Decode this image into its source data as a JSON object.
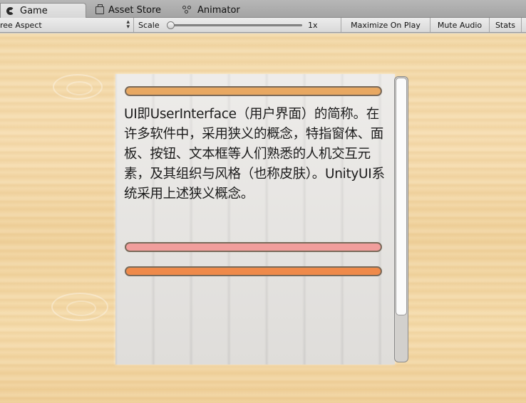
{
  "tabs": [
    {
      "label": "Game",
      "icon": "pacman-icon",
      "active": true
    },
    {
      "label": "Asset Store",
      "icon": "store-bag-icon",
      "active": false
    },
    {
      "label": "Animator",
      "icon": "nodes-icon",
      "active": false
    }
  ],
  "toolbar": {
    "aspect": "ree Aspect",
    "scale_label": "Scale",
    "scale_value": "1x",
    "maximize_label": "Maximize On Play",
    "mute_label": "Mute Audio",
    "stats_label": "Stats"
  },
  "panel": {
    "text": "UI即UserInterface（用户界面）的简称。在许多软件中，采用狭义的概念，特指窗体、面板、按钮、文本框等人们熟悉的人机交互元素，及其组织与风格（也称皮肤）。UnityUI系统采用上述狭义概念。",
    "bar_colors": [
      "#e8a862",
      "#f19e9c",
      "#ef8a4a"
    ]
  },
  "scroll": {
    "visible_fraction": 0.84,
    "position": 0.0
  }
}
